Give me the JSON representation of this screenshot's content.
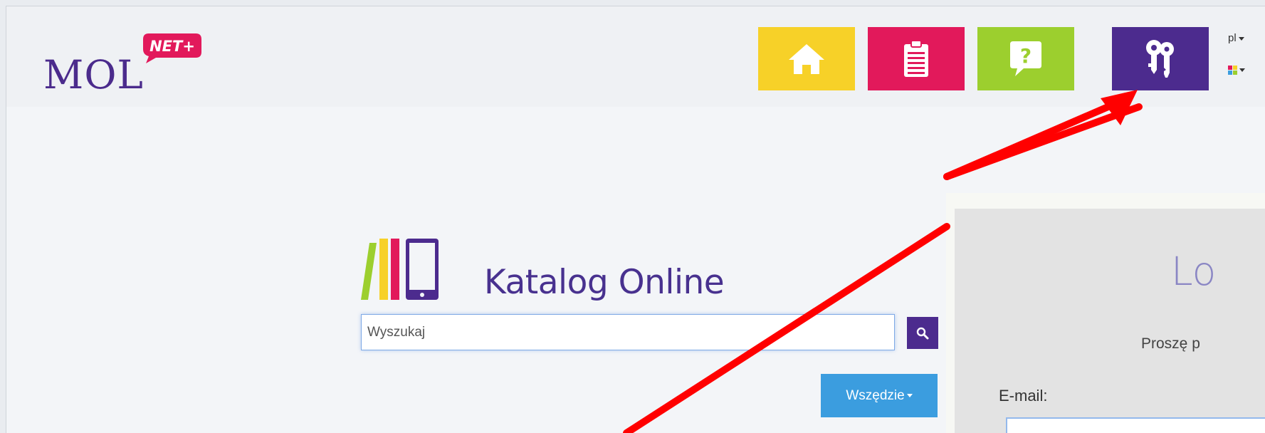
{
  "header": {
    "logo": {
      "text": "MOL",
      "badge": "NET+"
    },
    "nav_tiles": [
      {
        "name": "home",
        "icon": "home-icon",
        "color": "#f7d128"
      },
      {
        "name": "list",
        "icon": "clipboard-list-icon",
        "color": "#e2195b"
      },
      {
        "name": "help",
        "icon": "question-bubble-icon",
        "color": "#9ccf2e"
      },
      {
        "name": "login",
        "icon": "keys-icon",
        "color": "#4c2b8e"
      }
    ],
    "language": "pl",
    "color_scheme_icon": "color-grid-icon"
  },
  "catalog": {
    "title": "Katalog Online",
    "search": {
      "placeholder": "Wyszukaj",
      "value": ""
    },
    "search_icon": "search-icon",
    "scope_label": "Wszędzie"
  },
  "login_modal": {
    "title": "Lo",
    "prompt": "Proszę p",
    "email_label": "E-mail:",
    "email_value": ""
  },
  "annotation": {
    "arrow_color": "#ff0000"
  },
  "colors": {
    "brand_purple": "#4b2b8c",
    "accent_red": "#e2195b",
    "accent_yellow": "#f7d128",
    "accent_green": "#9ccf2e",
    "accent_blue": "#3b9ddf"
  }
}
